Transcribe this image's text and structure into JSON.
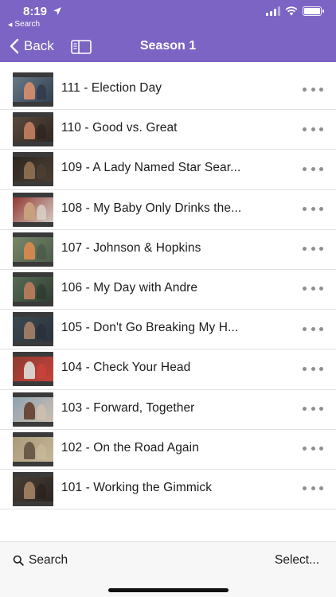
{
  "status_bar": {
    "time": "8:19",
    "back_to_app": "Search"
  },
  "nav": {
    "back_label": "Back",
    "title": "Season 1"
  },
  "episodes": [
    {
      "title": "111 - Election Day"
    },
    {
      "title": "110 - Good vs. Great"
    },
    {
      "title": "109 - A Lady Named Star Sear..."
    },
    {
      "title": "108 - My Baby Only Drinks the..."
    },
    {
      "title": "107 - Johnson & Hopkins"
    },
    {
      "title": "106 - My Day with Andre"
    },
    {
      "title": "105 - Don't Go Breaking My H..."
    },
    {
      "title": "104 - Check Your Head"
    },
    {
      "title": "103 - Forward, Together"
    },
    {
      "title": "102 - On the Road Again"
    },
    {
      "title": "101 - Working the Gimmick"
    }
  ],
  "toolbar": {
    "search_label": "Search",
    "select_label": "Select..."
  },
  "colors": {
    "header": "#7b64c4",
    "more_dots": "#8e8e93"
  },
  "icons": {
    "back": "chevron-left-icon",
    "sidebar": "sidebar-toggle-icon",
    "more": "more-horizontal-icon",
    "search": "search-icon"
  }
}
